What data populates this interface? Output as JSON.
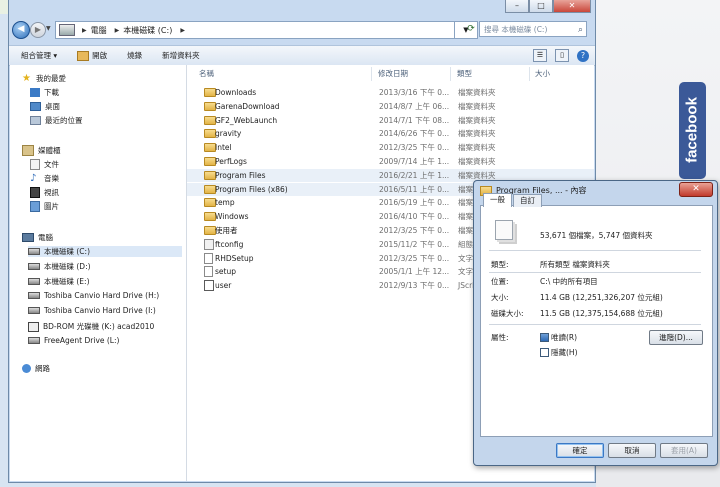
{
  "facebook": {
    "label": "facebook"
  },
  "window": {
    "min": "–",
    "max": "□",
    "close": "✕"
  },
  "address": {
    "crumbs": [
      "電腦",
      "本機磁碟 (C:)"
    ],
    "search_placeholder": "搜尋 本機磁碟 (C:)"
  },
  "toolbar": {
    "organize": "組合管理 ▾",
    "open": "開啟",
    "burn": "燒錄",
    "new_folder": "新增資料夾"
  },
  "nav": {
    "favorites": "我的最愛",
    "downloads": "下載",
    "desktop": "桌面",
    "recent": "最近的位置",
    "libraries": "媒體櫃",
    "documents": "文件",
    "music": "音樂",
    "videos": "視訊",
    "pictures": "圖片",
    "computer": "電腦",
    "drive_c": "本機磁碟 (C:)",
    "drive_d": "本機磁碟 (D:)",
    "drive_e": "本機磁碟 (E:)",
    "drive_h": "Toshiba Canvio Hard Drive (H:)",
    "drive_i": "Toshiba Canvio Hard Drive (I:)",
    "drive_k": "BD-ROM 光碟機 (K:) acad2010",
    "drive_l": "FreeAgent Drive (L:)",
    "network": "網路"
  },
  "columns": {
    "name": "名稱",
    "date": "修改日期",
    "type": "類型",
    "size": "大小"
  },
  "files": [
    {
      "name": "Downloads",
      "date": "2013/3/16 下午 0...",
      "type": "檔案資料夾",
      "icon": "folder"
    },
    {
      "name": "GarenaDownload",
      "date": "2014/8/7 上午 06...",
      "type": "檔案資料夾",
      "icon": "folder"
    },
    {
      "name": "GF2_WebLaunch",
      "date": "2014/7/1 下午 08...",
      "type": "檔案資料夾",
      "icon": "folder"
    },
    {
      "name": "gravity",
      "date": "2014/6/26 下午 0...",
      "type": "檔案資料夾",
      "icon": "folder"
    },
    {
      "name": "Intel",
      "date": "2012/3/25 下午 0...",
      "type": "檔案資料夾",
      "icon": "folder"
    },
    {
      "name": "PerfLogs",
      "date": "2009/7/14 上午 1...",
      "type": "檔案資料夾",
      "icon": "folder"
    },
    {
      "name": "Program Files",
      "date": "2016/2/21 上午 1...",
      "type": "檔案資料夾",
      "icon": "folder"
    },
    {
      "name": "Program Files (x86)",
      "date": "2016/5/11 上午 0...",
      "type": "檔案資料夾",
      "icon": "folder"
    },
    {
      "name": "temp",
      "date": "2016/5/19 上午 0...",
      "type": "檔案資料夾",
      "icon": "folder"
    },
    {
      "name": "Windows",
      "date": "2016/4/10 下午 0...",
      "type": "檔案資料夾",
      "icon": "folder"
    },
    {
      "name": "使用者",
      "date": "2012/3/25 下午 0...",
      "type": "檔案資料夾",
      "icon": "folder"
    },
    {
      "name": "ftconfig",
      "date": "2015/11/2 下午 0...",
      "type": "組態設",
      "icon": "cfg"
    },
    {
      "name": "RHDSetup",
      "date": "2012/3/25 下午 0...",
      "type": "文字文",
      "icon": "txt"
    },
    {
      "name": "setup",
      "date": "2005/1/1 上午 12...",
      "type": "文字文",
      "icon": "txt"
    },
    {
      "name": "user",
      "date": "2012/9/13 下午 0...",
      "type": "JScrip",
      "icon": "js"
    }
  ],
  "dialog": {
    "title": "Program Files, ... - 內容",
    "close": "✕",
    "tab_general": "一般",
    "tab_custom": "自訂",
    "summary": "53,671 個檔案，5,747 個資料夾",
    "type_label": "類型:",
    "type_value": "所有類型 檔案資料夾",
    "location_label": "位置:",
    "location_value": "C:\\ 中的所有項目",
    "size_label": "大小:",
    "size_value": "11.4 GB (12,251,326,207 位元組)",
    "disk_label": "磁碟大小:",
    "disk_value": "11.5 GB (12,375,154,688 位元組)",
    "attr_label": "屬性:",
    "readonly": "唯讀(R)",
    "hidden": "隱藏(H)",
    "advanced": "進階(D)...",
    "ok": "確定",
    "cancel": "取消",
    "apply": "套用(A)"
  }
}
